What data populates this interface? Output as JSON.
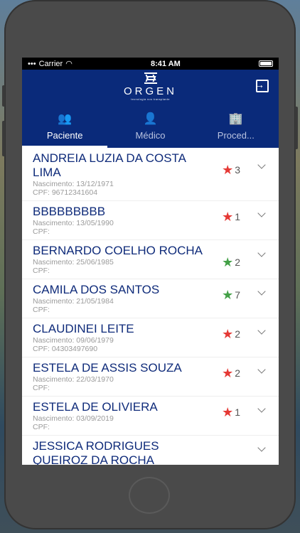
{
  "status": {
    "carrier": "Carrier",
    "time": "8:41 AM"
  },
  "header": {
    "logo": "ORGEN",
    "tagline": "tecnologia nos transplante"
  },
  "tabs": [
    {
      "label": "Paciente",
      "icon": "people-icon"
    },
    {
      "label": "Médico",
      "icon": "person-icon"
    },
    {
      "label": "Proced...",
      "icon": "building-icon"
    }
  ],
  "patients": [
    {
      "name": "ANDREIA LUZIA DA COSTA LIMA",
      "birth": "Nascimento: 13/12/1971",
      "cpf": "CPF: 96712341604",
      "stars": "3",
      "star_color": "#e53935"
    },
    {
      "name": "BBBBBBBBB",
      "birth": "Nascimento: 13/05/1990",
      "cpf": "CPF:",
      "stars": "1",
      "star_color": "#e53935"
    },
    {
      "name": "BERNARDO COELHO ROCHA",
      "birth": "Nascimento: 25/06/1985",
      "cpf": "CPF:",
      "stars": "2",
      "star_color": "#43a047"
    },
    {
      "name": "CAMILA DOS SANTOS",
      "birth": "Nascimento: 21/05/1984",
      "cpf": "CPF:",
      "stars": "7",
      "star_color": "#43a047"
    },
    {
      "name": "CLAUDINEI LEITE",
      "birth": "Nascimento: 09/06/1979",
      "cpf": "CPF: 04303497690",
      "stars": "2",
      "star_color": "#e53935"
    },
    {
      "name": "ESTELA DE ASSIS SOUZA",
      "birth": "Nascimento: 22/03/1970",
      "cpf": "CPF:",
      "stars": "2",
      "star_color": "#e53935"
    },
    {
      "name": "ESTELA DE OLIVIERA",
      "birth": "Nascimento: 03/09/2019",
      "cpf": "CPF:",
      "stars": "1",
      "star_color": "#e53935"
    },
    {
      "name": "JESSICA RODRIGUES QUEIROZ DA ROCHA",
      "birth": "",
      "cpf": "",
      "stars": "",
      "star_color": "#e53935"
    }
  ]
}
